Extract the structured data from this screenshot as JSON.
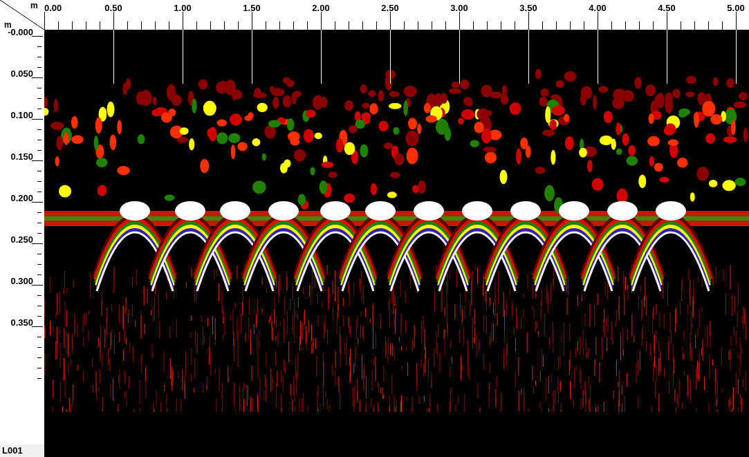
{
  "corner": {
    "x_unit": "m",
    "y_unit": "m"
  },
  "x_axis": {
    "labels": [
      "0.00",
      "0.50",
      "1.00",
      "1.50",
      "2.00",
      "2.50",
      "3.00",
      "3.50",
      "4.00",
      "4.50",
      "5.00"
    ]
  },
  "y_axis": {
    "labels": [
      "-0.000",
      "0.050",
      "0.100",
      "0.150",
      "0.200",
      "0.250",
      "0.300",
      "0.350"
    ]
  },
  "profile": {
    "label": "L001"
  }
}
